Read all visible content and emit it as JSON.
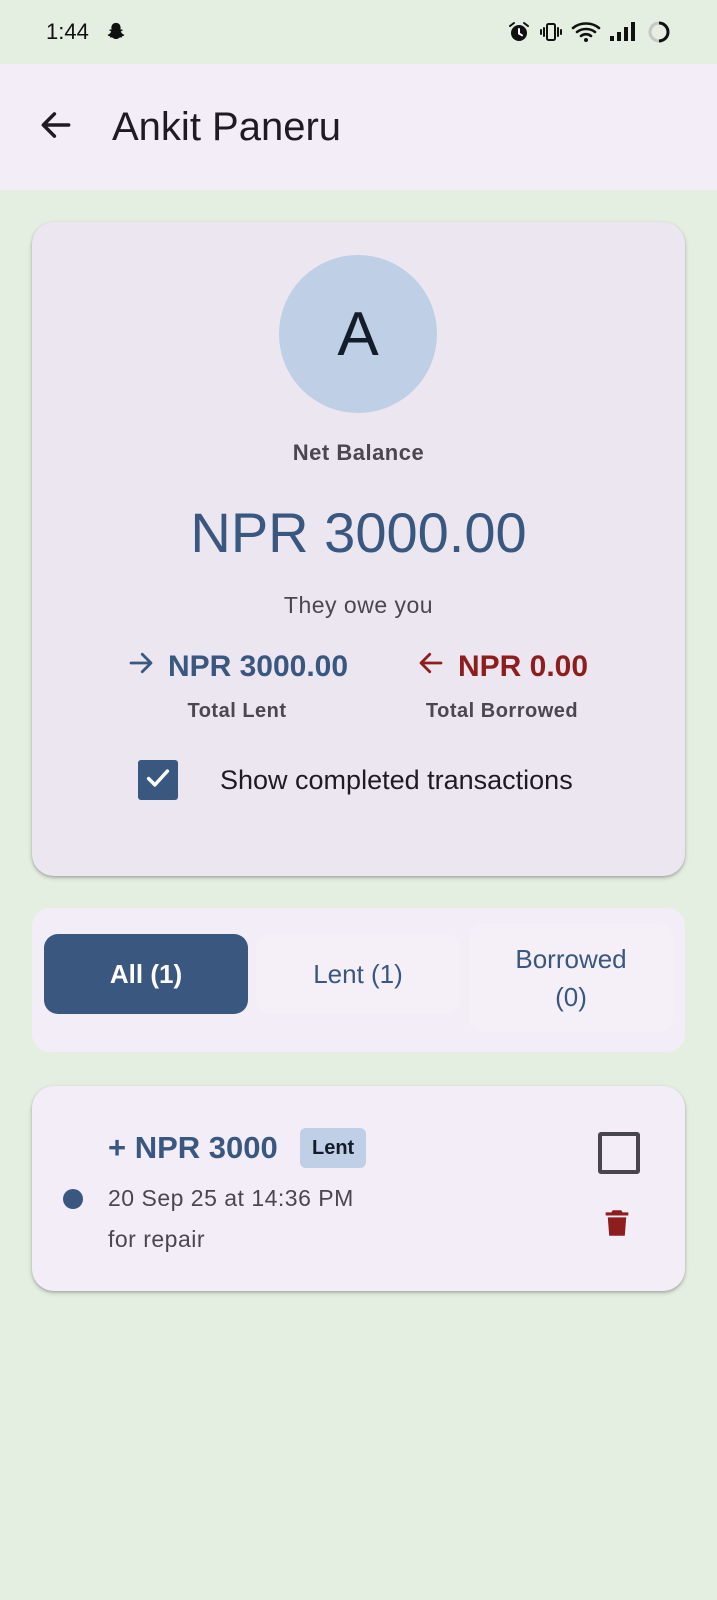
{
  "status_bar": {
    "time": "1:44",
    "icons": [
      "snapchat-icon",
      "alarm-icon",
      "vibrate-icon",
      "wifi-icon",
      "signal-icon",
      "battery-icon"
    ]
  },
  "app_bar": {
    "title": "Ankit Paneru",
    "back_icon": "arrow-back-icon"
  },
  "summary": {
    "avatar_letter": "A",
    "net_balance_label": "Net Balance",
    "net_balance_value": "NPR 3000.00",
    "direction_text": "They owe you",
    "total_lent_value": "NPR 3000.00",
    "total_lent_label": "Total Lent",
    "total_borrowed_value": "NPR 0.00",
    "total_borrowed_label": "Total Borrowed",
    "show_completed_label": "Show completed transactions",
    "show_completed_checked": true
  },
  "filters": {
    "all_label": "All (1)",
    "lent_label": "Lent (1)",
    "borrowed_label": "Borrowed (0)",
    "selected": "All (1)"
  },
  "transactions": [
    {
      "amount": "+ NPR 3000",
      "type_badge": "Lent",
      "datetime": "20 Sep 25 at 14:36 PM",
      "note": "for repair",
      "completed": false
    }
  ],
  "colors": {
    "background": "#e4eee1",
    "primary": "#3a5780",
    "negative": "#8e1d1d",
    "surface": "#f2edf6",
    "card": "#ebe6ef",
    "avatar": "#bfcfe6"
  }
}
